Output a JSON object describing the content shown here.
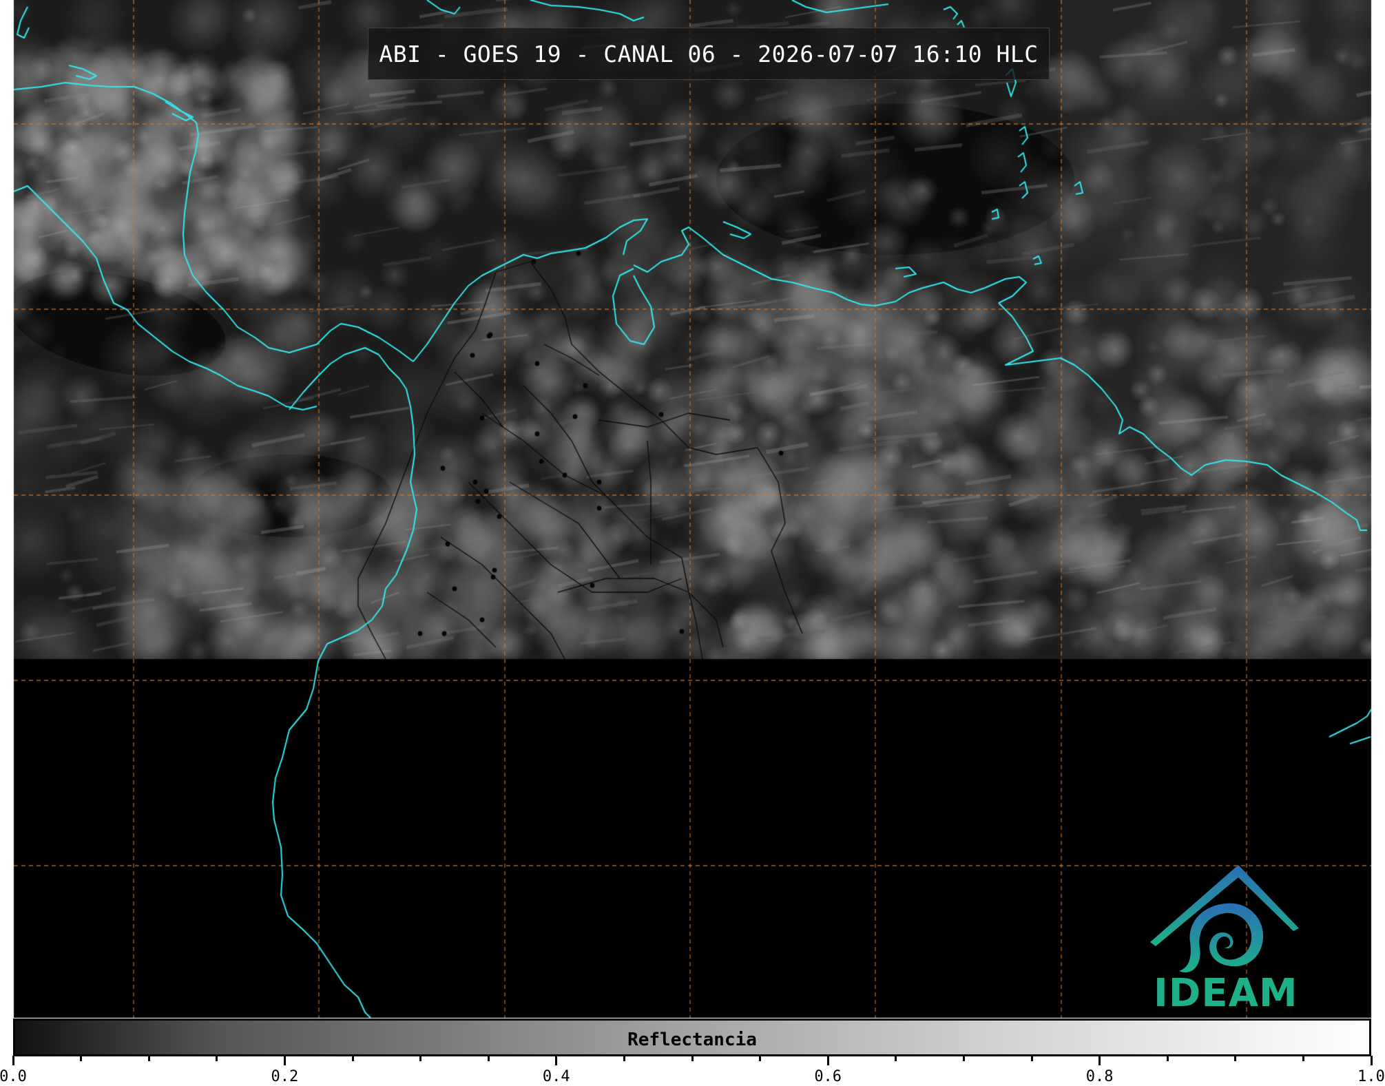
{
  "title": "ABI - GOES 19 - CANAL 06 - 2026-07-07 16:10 HLC",
  "colorbar": {
    "label": "Reflectancia",
    "min": 0.0,
    "max": 1.0,
    "ticks": [
      "0.0",
      "0.2",
      "0.4",
      "0.6",
      "0.8",
      "1.0"
    ],
    "minor_tick_step": 0.05
  },
  "logo": {
    "text": "IDEAM"
  },
  "colors": {
    "coastline": "#33e8ee",
    "graticule": "#d2782c",
    "borders": "#0a0a0a",
    "logo_green": "#1fb089",
    "logo_blue": "#2a6fb5"
  },
  "graticule": {
    "style": "dashed"
  }
}
